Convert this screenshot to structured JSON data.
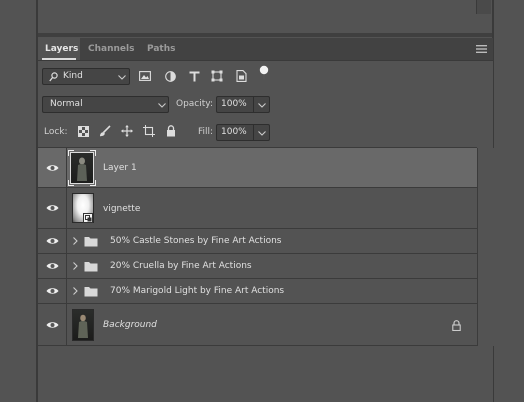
{
  "panel": {
    "tabs": [
      {
        "label": "Layers",
        "active": true
      },
      {
        "label": "Channels",
        "active": false
      },
      {
        "label": "Paths",
        "active": false
      }
    ],
    "menu_icon": "hamburger-menu-icon"
  },
  "filter": {
    "kind_label": "Kind",
    "icons": [
      "image-filter-icon",
      "adjustment-filter-icon",
      "type-filter-icon",
      "shape-filter-icon",
      "smart-object-filter-icon",
      "filter-toggle-icon"
    ]
  },
  "blend": {
    "mode": "Normal",
    "opacity_label": "Opacity:",
    "opacity_value": "100%"
  },
  "lock": {
    "label": "Lock:",
    "icons": [
      "lock-transparent-pixels-icon",
      "lock-image-pixels-icon",
      "lock-position-icon",
      "lock-artboard-icon",
      "lock-all-icon"
    ],
    "fill_label": "Fill:",
    "fill_value": "100%"
  },
  "layers": [
    {
      "name": "Layer 1",
      "type": "pixel",
      "visible": true,
      "selected": true
    },
    {
      "name": "vignette",
      "type": "smart-object",
      "visible": true,
      "selected": false
    },
    {
      "name": "50% Castle Stones by Fine Art Actions",
      "type": "group",
      "visible": true,
      "selected": false
    },
    {
      "name": "20% Cruella by Fine Art Actions",
      "type": "group",
      "visible": true,
      "selected": false
    },
    {
      "name": "70% Marigold Light by Fine Art Actions",
      "type": "group",
      "visible": true,
      "selected": false
    },
    {
      "name": "Background",
      "type": "background",
      "visible": true,
      "selected": false,
      "locked": true
    }
  ],
  "colors": {
    "panel_bg": "#535353",
    "selected_row": "#696969",
    "tab_bar": "#424242"
  }
}
